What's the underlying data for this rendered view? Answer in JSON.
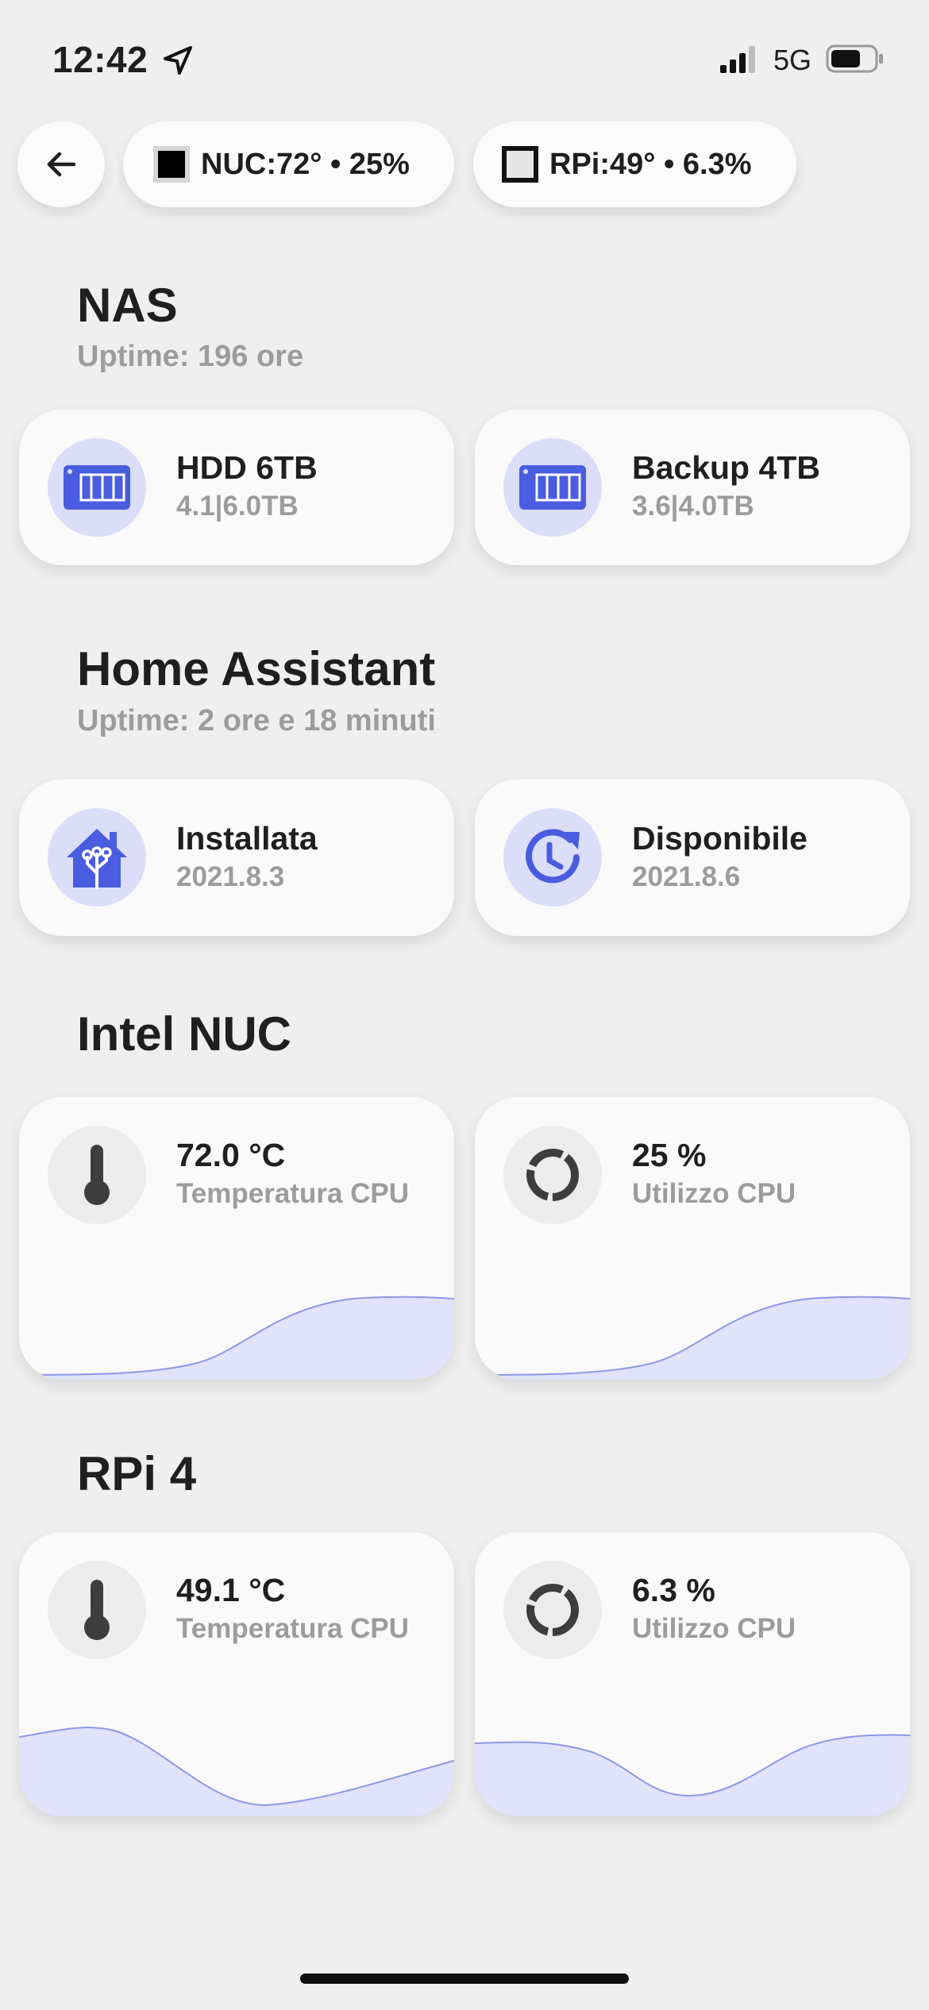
{
  "status_bar": {
    "time": "12:42",
    "network": "5G",
    "icons": [
      "location-arrow-icon",
      "signal-bars-icon",
      "battery-icon"
    ]
  },
  "chips": {
    "nuc": {
      "label": "NUC:72° • 25%"
    },
    "rpi": {
      "label": "RPi:49° • 6.3%"
    }
  },
  "sections": {
    "nas": {
      "title": "NAS",
      "subtitle": "Uptime: 196 ore",
      "cards": [
        {
          "title": "HDD 6TB",
          "subtitle": "4.1|6.0TB",
          "icon": "nas-drive-icon"
        },
        {
          "title": "Backup 4TB",
          "subtitle": "3.6|4.0TB",
          "icon": "nas-drive-icon"
        }
      ]
    },
    "home_assistant": {
      "title": "Home Assistant",
      "subtitle": "Uptime: 2 ore e 18 minuti",
      "cards": [
        {
          "title": "Installata",
          "subtitle": "2021.8.3",
          "icon": "home-assistant-icon"
        },
        {
          "title": "Disponibile",
          "subtitle": "2021.8.6",
          "icon": "update-clock-icon"
        }
      ]
    },
    "intel_nuc": {
      "title": "Intel NUC",
      "cards": [
        {
          "title": "72.0 °C",
          "subtitle": "Temperatura CPU",
          "icon": "thermometer-icon"
        },
        {
          "title": "25 %",
          "subtitle": "Utilizzo CPU",
          "icon": "cpu-load-icon"
        }
      ]
    },
    "rpi4": {
      "title": "RPi 4",
      "cards": [
        {
          "title": "49.1 °C",
          "subtitle": "Temperatura CPU",
          "icon": "thermometer-icon"
        },
        {
          "title": "6.3 %",
          "subtitle": "Utilizzo CPU",
          "icon": "cpu-load-icon"
        }
      ]
    }
  },
  "colors": {
    "accent": "#4a5ce0",
    "accent_soft": "#dadef9",
    "sparkline_fill": "#e0e3fa",
    "sparkline_line": "#8d97e8",
    "background": "#efefef",
    "card": "#fafafa",
    "muted_text": "#9c9c9c"
  }
}
